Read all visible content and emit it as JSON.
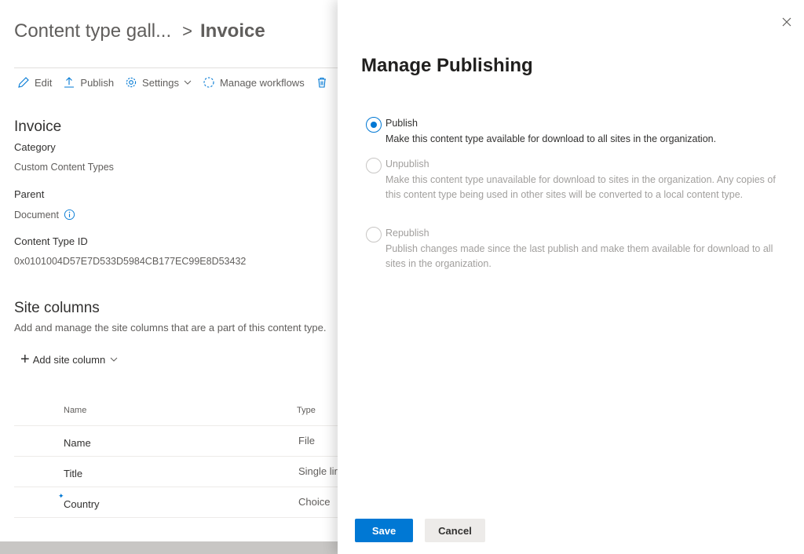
{
  "breadcrumb": {
    "root": "Content type gall...",
    "separator": ">",
    "current": "Invoice"
  },
  "commandbar": {
    "edit": "Edit",
    "publish": "Publish",
    "settings": "Settings",
    "manage_workflows": "Manage workflows"
  },
  "info": {
    "title": "Invoice",
    "category_label": "Category",
    "category_value": "Custom Content Types",
    "parent_label": "Parent",
    "parent_value": "Document",
    "id_label": "Content Type ID",
    "id_value": "0x0101004D57E7D533D5984CB177EC99E8D53432"
  },
  "site_columns": {
    "title": "Site columns",
    "description": "Add and manage the site columns that are a part of this content type.",
    "add_label": "Add site column",
    "headers": {
      "name": "Name",
      "type": "Type"
    },
    "rows": [
      {
        "name": "Name",
        "type": "File"
      },
      {
        "name": "Title",
        "type": "Single lir"
      },
      {
        "name": "Country",
        "type": "Choice"
      }
    ]
  },
  "panel": {
    "title": "Manage Publishing",
    "options": [
      {
        "label": "Publish",
        "description": "Make this content type available for download to all sites in the organization.",
        "checked": true,
        "disabled": false
      },
      {
        "label": "Unpublish",
        "description": "Make this content type unavailable for download to sites in the organization. Any copies of this content type being used in other sites will be converted to a local content type.",
        "checked": false,
        "disabled": true
      },
      {
        "label": "Republish",
        "description": "Publish changes made since the last publish and make them available for download to all sites in the organization.",
        "checked": false,
        "disabled": true
      }
    ],
    "save_label": "Save",
    "cancel_label": "Cancel"
  },
  "colors": {
    "accent": "#0078d4",
    "text_primary": "#323130",
    "text_secondary": "#605e5c",
    "text_disabled": "#a19f9d"
  },
  "icons": {
    "edit": "pencil-icon",
    "publish": "upload-icon",
    "settings": "gear-icon",
    "workflows": "workflow-icon",
    "delete": "trash-icon",
    "info": "info-icon",
    "close": "close-icon",
    "add": "plus-icon",
    "chevron": "chevron-down-icon"
  }
}
